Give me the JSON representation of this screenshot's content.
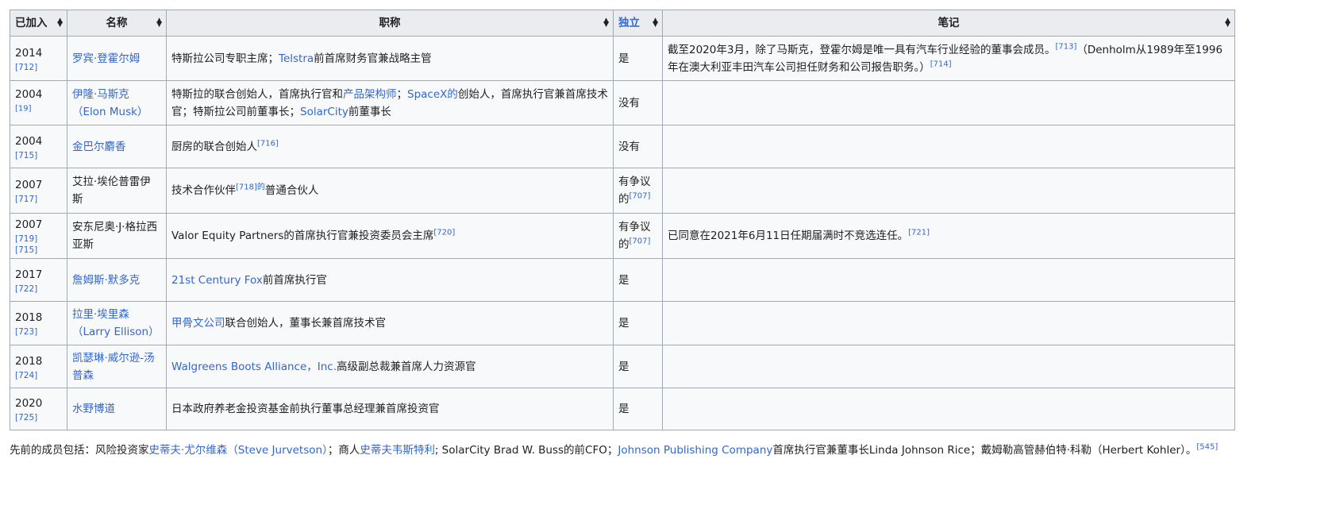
{
  "colors": {
    "link": "#3366cc",
    "header_bg": "#eaecf0",
    "cell_bg": "#f8f9fa",
    "border": "#a2a9b1"
  },
  "headers": {
    "joined": "已加入",
    "name": "名称",
    "title": "职称",
    "independent": "独立",
    "notes": "笔记"
  },
  "rows": [
    {
      "year": "2014",
      "ref": "[712]",
      "ref_inline": false,
      "name": [
        {
          "t": "罗宾·登霍尔姆",
          "k": "a"
        }
      ],
      "title": [
        {
          "t": "特斯拉公司专职主席；",
          "k": ""
        },
        {
          "t": "Telstra",
          "k": "a"
        },
        {
          "t": "前首席财务官兼战略主管",
          "k": ""
        }
      ],
      "independent": [
        {
          "t": "是",
          "k": ""
        }
      ],
      "notes": [
        {
          "t": "截至2020年3月，除了马斯克，登霍尔姆是唯一具有汽车行业经验的董事会成员。",
          "k": ""
        },
        {
          "t": "[713]",
          "k": "s"
        },
        {
          "t": "（Denholm从1989年至1996年在澳大利亚丰田汽车公司担任财务和公司报告职务。）",
          "k": ""
        },
        {
          "t": "[714]",
          "k": "s"
        }
      ]
    },
    {
      "year": "2004",
      "ref": "[19]",
      "ref_inline": true,
      "name": [
        {
          "t": "伊隆·马斯克（Elon Musk）",
          "k": "a"
        }
      ],
      "title": [
        {
          "t": "特斯拉的联合创始人，首席执行官和",
          "k": ""
        },
        {
          "t": "产品架构师",
          "k": "a"
        },
        {
          "t": "；",
          "k": ""
        },
        {
          "t": "SpaceX的",
          "k": "a"
        },
        {
          "t": "创始人，首席执行官兼首席技术官；特斯拉公司前董事长；",
          "k": ""
        },
        {
          "t": "SolarCity",
          "k": "a"
        },
        {
          "t": "前董事长",
          "k": ""
        }
      ],
      "independent": [
        {
          "t": "没有",
          "k": ""
        }
      ],
      "notes": []
    },
    {
      "year": "2004",
      "ref": "[715]",
      "ref_inline": false,
      "name": [
        {
          "t": "金巴尔麝香",
          "k": "a"
        }
      ],
      "title": [
        {
          "t": "厨房的联合创始人",
          "k": ""
        },
        {
          "t": "[716]",
          "k": "s"
        }
      ],
      "independent": [
        {
          "t": "没有",
          "k": ""
        }
      ],
      "notes": []
    },
    {
      "year": "2007",
      "ref": "[717]",
      "ref_inline": false,
      "name": [
        {
          "t": "艾拉·埃伦普雷伊斯",
          "k": ""
        }
      ],
      "title": [
        {
          "t": "技术合作伙伴",
          "k": ""
        },
        {
          "t": "[718]的",
          "k": "s"
        },
        {
          "t": "普通合伙人",
          "k": ""
        }
      ],
      "independent": [
        {
          "t": "有争议的",
          "k": ""
        },
        {
          "t": "[707]",
          "k": "s"
        }
      ],
      "notes": []
    },
    {
      "year": "2007",
      "ref": "[719] [715]",
      "ref_inline": false,
      "name": [
        {
          "t": "安东尼奥·J·格拉西亚斯",
          "k": ""
        }
      ],
      "title": [
        {
          "t": "Valor Equity Partners的首席执行官兼投资委员会主席",
          "k": ""
        },
        {
          "t": "[720]",
          "k": "s"
        }
      ],
      "independent": [
        {
          "t": "有争议的",
          "k": ""
        },
        {
          "t": "[707]",
          "k": "s"
        }
      ],
      "notes": [
        {
          "t": "已同意在2021年6月11日任期届满时不竞选连任。",
          "k": ""
        },
        {
          "t": "[721]",
          "k": "s"
        }
      ]
    },
    {
      "year": "2017",
      "ref": "[722]",
      "ref_inline": false,
      "name": [
        {
          "t": "詹姆斯·默多克",
          "k": "a"
        }
      ],
      "title": [
        {
          "t": "21st Century Fox",
          "k": "a"
        },
        {
          "t": "前首席执行官",
          "k": ""
        }
      ],
      "independent": [
        {
          "t": "是",
          "k": ""
        }
      ],
      "notes": []
    },
    {
      "year": "2018",
      "ref": "[723]",
      "ref_inline": false,
      "name": [
        {
          "t": "拉里·埃里森（Larry Ellison）",
          "k": "a"
        }
      ],
      "title": [
        {
          "t": "甲骨文公司",
          "k": "a"
        },
        {
          "t": "联合创始人，董事长兼首席技术官",
          "k": ""
        }
      ],
      "independent": [
        {
          "t": "是",
          "k": ""
        }
      ],
      "notes": []
    },
    {
      "year": "2018",
      "ref": "[724]",
      "ref_inline": false,
      "name": [
        {
          "t": "凯瑟琳·威尔逊-汤普森",
          "k": "a"
        }
      ],
      "title": [
        {
          "t": "Walgreens Boots Alliance，Inc.",
          "k": "a"
        },
        {
          "t": "高级副总裁兼首席人力资源官",
          "k": ""
        }
      ],
      "independent": [
        {
          "t": "是",
          "k": ""
        }
      ],
      "notes": []
    },
    {
      "year": "2020",
      "ref": "[725]",
      "ref_inline": false,
      "name": [
        {
          "t": "水野博道",
          "k": "a"
        }
      ],
      "title": [
        {
          "t": "日本政府养老金投资基金前执行董事总经理兼首席投资官",
          "k": ""
        }
      ],
      "independent": [
        {
          "t": "是",
          "k": ""
        }
      ],
      "notes": []
    }
  ],
  "footer": [
    {
      "t": "先前的成员包括：风险投资家",
      "k": ""
    },
    {
      "t": "史蒂夫·尤尔维森（Steve Jurvetson）",
      "k": "a"
    },
    {
      "t": "；商人",
      "k": ""
    },
    {
      "t": "史蒂夫韦斯特利",
      "k": "a"
    },
    {
      "t": "; SolarCity Brad W. Buss的前CFO；",
      "k": ""
    },
    {
      "t": "Johnson Publishing Company",
      "k": "a"
    },
    {
      "t": "首席执行官兼董事长Linda Johnson Rice；戴姆勒高管赫伯特·科勒（Herbert Kohler）。",
      "k": ""
    },
    {
      "t": "[545]",
      "k": "s"
    }
  ]
}
